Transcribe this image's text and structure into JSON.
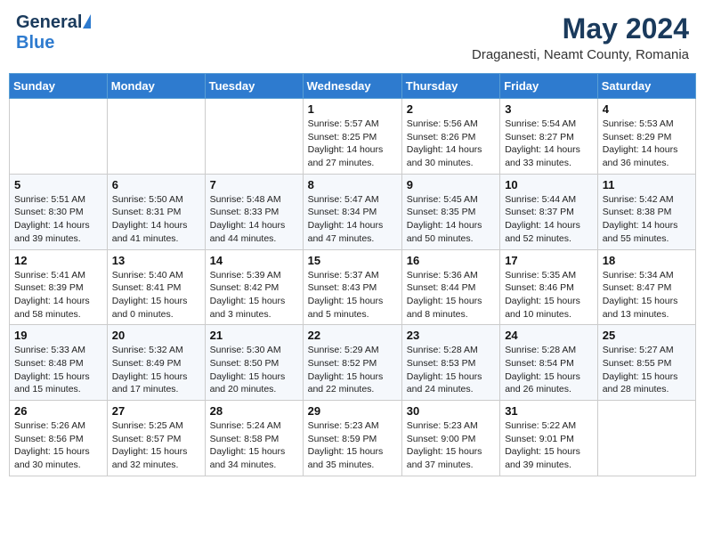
{
  "header": {
    "logo_general": "General",
    "logo_blue": "Blue",
    "month_year": "May 2024",
    "location": "Draganesti, Neamt County, Romania"
  },
  "days_of_week": [
    "Sunday",
    "Monday",
    "Tuesday",
    "Wednesday",
    "Thursday",
    "Friday",
    "Saturday"
  ],
  "weeks": [
    [
      {
        "day": "",
        "info": ""
      },
      {
        "day": "",
        "info": ""
      },
      {
        "day": "",
        "info": ""
      },
      {
        "day": "1",
        "info": "Sunrise: 5:57 AM\nSunset: 8:25 PM\nDaylight: 14 hours\nand 27 minutes."
      },
      {
        "day": "2",
        "info": "Sunrise: 5:56 AM\nSunset: 8:26 PM\nDaylight: 14 hours\nand 30 minutes."
      },
      {
        "day": "3",
        "info": "Sunrise: 5:54 AM\nSunset: 8:27 PM\nDaylight: 14 hours\nand 33 minutes."
      },
      {
        "day": "4",
        "info": "Sunrise: 5:53 AM\nSunset: 8:29 PM\nDaylight: 14 hours\nand 36 minutes."
      }
    ],
    [
      {
        "day": "5",
        "info": "Sunrise: 5:51 AM\nSunset: 8:30 PM\nDaylight: 14 hours\nand 39 minutes."
      },
      {
        "day": "6",
        "info": "Sunrise: 5:50 AM\nSunset: 8:31 PM\nDaylight: 14 hours\nand 41 minutes."
      },
      {
        "day": "7",
        "info": "Sunrise: 5:48 AM\nSunset: 8:33 PM\nDaylight: 14 hours\nand 44 minutes."
      },
      {
        "day": "8",
        "info": "Sunrise: 5:47 AM\nSunset: 8:34 PM\nDaylight: 14 hours\nand 47 minutes."
      },
      {
        "day": "9",
        "info": "Sunrise: 5:45 AM\nSunset: 8:35 PM\nDaylight: 14 hours\nand 50 minutes."
      },
      {
        "day": "10",
        "info": "Sunrise: 5:44 AM\nSunset: 8:37 PM\nDaylight: 14 hours\nand 52 minutes."
      },
      {
        "day": "11",
        "info": "Sunrise: 5:42 AM\nSunset: 8:38 PM\nDaylight: 14 hours\nand 55 minutes."
      }
    ],
    [
      {
        "day": "12",
        "info": "Sunrise: 5:41 AM\nSunset: 8:39 PM\nDaylight: 14 hours\nand 58 minutes."
      },
      {
        "day": "13",
        "info": "Sunrise: 5:40 AM\nSunset: 8:41 PM\nDaylight: 15 hours\nand 0 minutes."
      },
      {
        "day": "14",
        "info": "Sunrise: 5:39 AM\nSunset: 8:42 PM\nDaylight: 15 hours\nand 3 minutes."
      },
      {
        "day": "15",
        "info": "Sunrise: 5:37 AM\nSunset: 8:43 PM\nDaylight: 15 hours\nand 5 minutes."
      },
      {
        "day": "16",
        "info": "Sunrise: 5:36 AM\nSunset: 8:44 PM\nDaylight: 15 hours\nand 8 minutes."
      },
      {
        "day": "17",
        "info": "Sunrise: 5:35 AM\nSunset: 8:46 PM\nDaylight: 15 hours\nand 10 minutes."
      },
      {
        "day": "18",
        "info": "Sunrise: 5:34 AM\nSunset: 8:47 PM\nDaylight: 15 hours\nand 13 minutes."
      }
    ],
    [
      {
        "day": "19",
        "info": "Sunrise: 5:33 AM\nSunset: 8:48 PM\nDaylight: 15 hours\nand 15 minutes."
      },
      {
        "day": "20",
        "info": "Sunrise: 5:32 AM\nSunset: 8:49 PM\nDaylight: 15 hours\nand 17 minutes."
      },
      {
        "day": "21",
        "info": "Sunrise: 5:30 AM\nSunset: 8:50 PM\nDaylight: 15 hours\nand 20 minutes."
      },
      {
        "day": "22",
        "info": "Sunrise: 5:29 AM\nSunset: 8:52 PM\nDaylight: 15 hours\nand 22 minutes."
      },
      {
        "day": "23",
        "info": "Sunrise: 5:28 AM\nSunset: 8:53 PM\nDaylight: 15 hours\nand 24 minutes."
      },
      {
        "day": "24",
        "info": "Sunrise: 5:28 AM\nSunset: 8:54 PM\nDaylight: 15 hours\nand 26 minutes."
      },
      {
        "day": "25",
        "info": "Sunrise: 5:27 AM\nSunset: 8:55 PM\nDaylight: 15 hours\nand 28 minutes."
      }
    ],
    [
      {
        "day": "26",
        "info": "Sunrise: 5:26 AM\nSunset: 8:56 PM\nDaylight: 15 hours\nand 30 minutes."
      },
      {
        "day": "27",
        "info": "Sunrise: 5:25 AM\nSunset: 8:57 PM\nDaylight: 15 hours\nand 32 minutes."
      },
      {
        "day": "28",
        "info": "Sunrise: 5:24 AM\nSunset: 8:58 PM\nDaylight: 15 hours\nand 34 minutes."
      },
      {
        "day": "29",
        "info": "Sunrise: 5:23 AM\nSunset: 8:59 PM\nDaylight: 15 hours\nand 35 minutes."
      },
      {
        "day": "30",
        "info": "Sunrise: 5:23 AM\nSunset: 9:00 PM\nDaylight: 15 hours\nand 37 minutes."
      },
      {
        "day": "31",
        "info": "Sunrise: 5:22 AM\nSunset: 9:01 PM\nDaylight: 15 hours\nand 39 minutes."
      },
      {
        "day": "",
        "info": ""
      }
    ]
  ]
}
